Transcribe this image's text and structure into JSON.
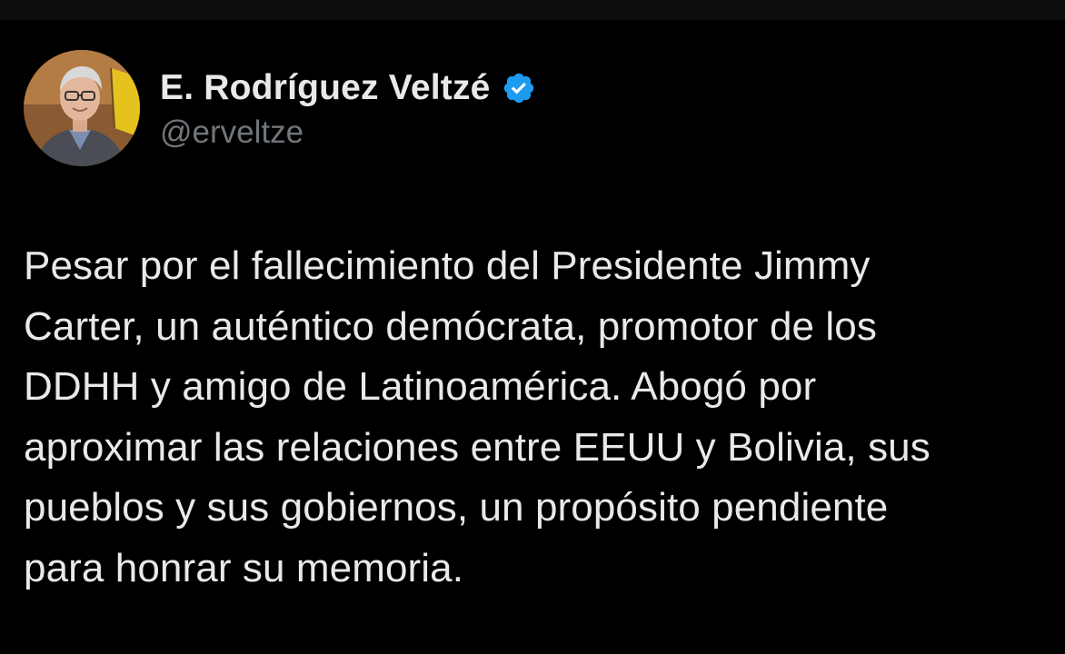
{
  "author": {
    "display_name": "E. Rodríguez Veltzé",
    "handle": "@erveltze",
    "verified": true,
    "avatar_icon": "profile-photo",
    "verified_icon": "verified-badge-icon"
  },
  "tweet": {
    "text": "Pesar por el fallecimiento del Presidente Jimmy\nCarter, un auténtico demócrata, promotor de los\nDDHH y amigo de Latinoamérica. Abogó por\naproximar las relaciones entre EEUU y Bolivia, sus\npueblos y sus gobiernos, un propósito pendiente\npara honrar su memoria."
  },
  "colors": {
    "background": "#000000",
    "text_primary": "#e7e9ea",
    "text_secondary": "#71767b",
    "verified_blue": "#1d9bf0"
  }
}
